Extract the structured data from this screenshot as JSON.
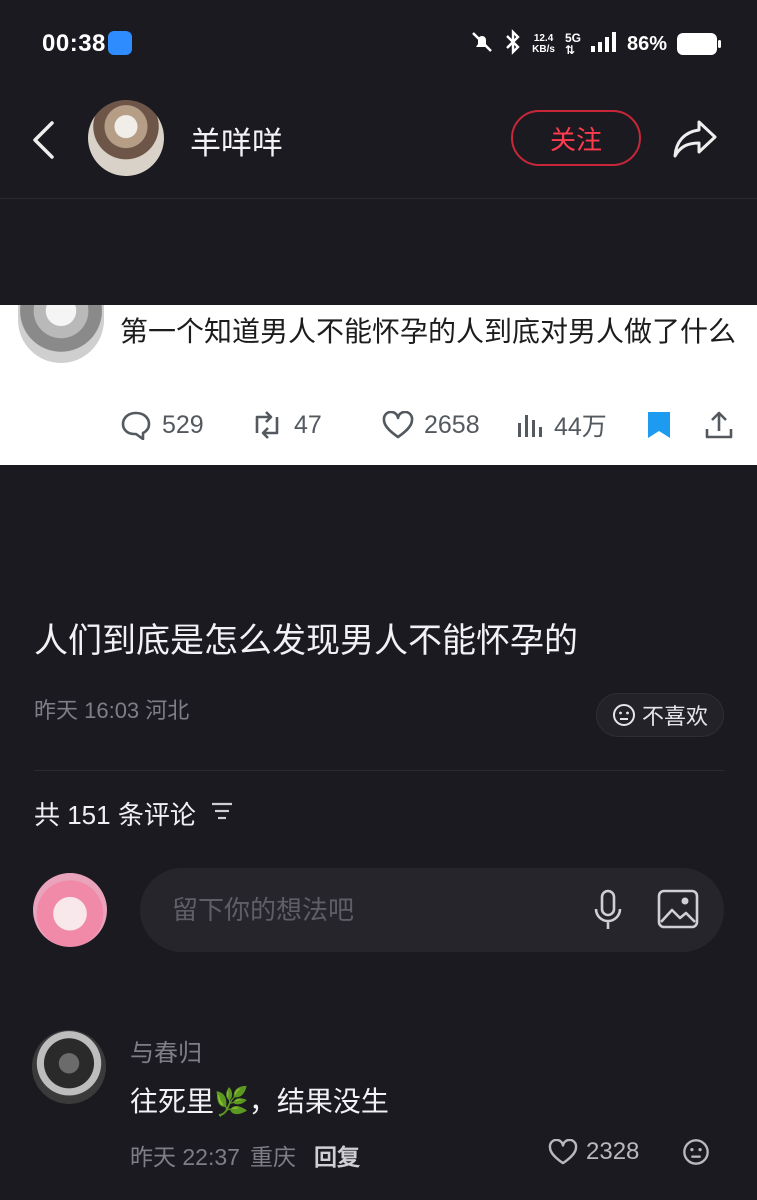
{
  "status_bar": {
    "time": "00:38",
    "net_speed_value": "12.4",
    "net_speed_unit": "KB/s",
    "network_type": "5G",
    "battery": "86%"
  },
  "header": {
    "username": "羊咩咩",
    "follow_label": "关注"
  },
  "tweet": {
    "text": "第一个知道男人不能怀孕的人到底对男人做了什么",
    "replies": "529",
    "retweets": "47",
    "likes": "2658",
    "views": "44万"
  },
  "post": {
    "title": "人们到底是怎么发现男人不能怀孕的",
    "meta": "昨天 16:03 河北",
    "dislike_label": "不喜欢",
    "comment_count_label": "共 151 条评论"
  },
  "comment_box": {
    "placeholder": "留下你的想法吧"
  },
  "comments": [
    {
      "user": "与春归",
      "text": "往死里🌿，结果没生",
      "time": "昨天 22:37",
      "location": "重庆",
      "reply_label": "回复",
      "likes": "2328"
    }
  ],
  "colors": {
    "background": "#1b1a20",
    "follow_accent": "#ff3b4f",
    "bookmark_blue": "#1d9bf0",
    "muted_text": "#7f7e86"
  }
}
